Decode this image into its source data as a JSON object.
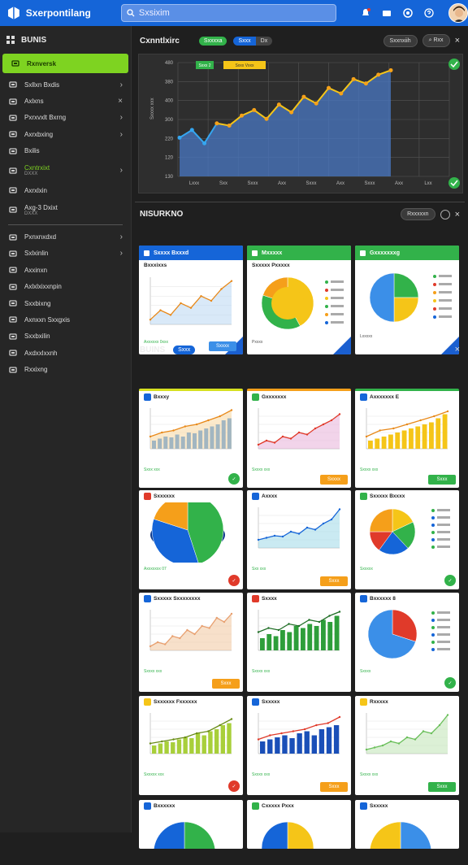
{
  "app": {
    "title": "Sxerpontilang",
    "search_placeholder": "Sxsixim"
  },
  "sidebar": {
    "header": "BUNIS",
    "items": [
      {
        "label": "Rxnversk",
        "active": true
      },
      {
        "label": "Sxllxn Bxdis",
        "chev": "›"
      },
      {
        "label": "Axlxns",
        "chev": "×"
      },
      {
        "label": "Pxrxvxlt Bxrng",
        "chev": "›"
      },
      {
        "label": "Axrxbxing",
        "chev": "›"
      },
      {
        "label": "Bxilis"
      },
      {
        "label": "Cxntrxixt",
        "sub": "DXXX",
        "green": true,
        "chev": "›"
      },
      {
        "label": "Axrxlxin"
      },
      {
        "label": "Axg-3 Dxixt",
        "sub": "DXXX"
      },
      {
        "label": "Pxnxnxdxd",
        "chev": "›"
      },
      {
        "label": "Sxlxinlin",
        "chev": "›"
      },
      {
        "label": "Axxinxn"
      },
      {
        "label": "Axlxlxixxnpin"
      },
      {
        "label": "Sxxbixng"
      },
      {
        "label": "Axnxxn Sxxgxis"
      },
      {
        "label": "Sxxbxilin"
      },
      {
        "label": "Axdxxlxxnh"
      },
      {
        "label": "Rxxixng"
      }
    ]
  },
  "overview": {
    "title": "Cxnntlxirc",
    "pill_a": "Sxxxxa",
    "pill_b": "Sxxx",
    "pill_c": "Dx",
    "btn_a": "Sxxnxiih",
    "btn_b": "Rxx",
    "chart_data": {
      "type": "line",
      "yticks": [
        "480",
        "380",
        "400",
        "300",
        "220",
        "120",
        "130"
      ],
      "xticks": [
        "Lxxx",
        "Sxx",
        "Sxxx",
        "Axx",
        "Sxxx",
        "Axx",
        "Sxxx",
        "Axx",
        "Lxx"
      ],
      "callout_a": "Sxxx 2",
      "callout_b": "Sxxx Vxxx",
      "values": [
        0.35,
        0.42,
        0.3,
        0.48,
        0.46,
        0.55,
        0.6,
        0.52,
        0.65,
        0.58,
        0.72,
        0.66,
        0.8,
        0.75,
        0.88,
        0.84,
        0.92,
        0.96
      ]
    }
  },
  "section2": {
    "title": "NISURKNO",
    "btn": "Rxxxxxn",
    "cards": [
      {
        "head": "Sxxxx Bxxxd",
        "title": "Bxxxixxs",
        "foot": "Axxxxxx 0xxx",
        "badge": "Sxxxx"
      },
      {
        "head": "Mxxxxx",
        "title": "Sxxxxx Pxxxxx",
        "foot": "Pxxxx"
      },
      {
        "head": "Gxxxxxxxg",
        "title": "",
        "foot": "Lxxxxx"
      }
    ]
  },
  "section3": {
    "title": "BUINS",
    "pill": "Sxxx",
    "cards": [
      {
        "title": "Bxxxy",
        "foot": "Sxxx xxx",
        "badge": ""
      },
      {
        "title": "Gxxxxxxx",
        "foot": "Sxxxx xxx",
        "badge": "Sxxxx"
      },
      {
        "title": "Axxxxxxx E",
        "foot": "Sxxxx xxx",
        "badge": "Sxxx"
      },
      {
        "title": "Sxxxxxx",
        "foot": "Axxxxxxx 07",
        "badge": ""
      },
      {
        "title": "Axxxx",
        "foot": "Sxx xxx",
        "badge": "Sxxx"
      },
      {
        "title": "Sxxxxx Bxxxx",
        "foot": "Sxxxxx",
        "badge": ""
      },
      {
        "title": "Sxxxxx Sxxxxxxxx",
        "foot": "Sxxxx xxx",
        "badge": "Sxxx"
      },
      {
        "title": "Sxxxx",
        "foot": "Sxxxx xxx",
        "badge": ""
      },
      {
        "title": "Bxxxxxx 8",
        "foot": "Sxxxx",
        "badge": ""
      },
      {
        "title": "Sxxxxxx Fxxxxxx",
        "foot": "Sxxxxx xxx",
        "badge": ""
      },
      {
        "title": "Sxxxxx",
        "foot": "Sxxxx xxx",
        "badge": "Sxxx"
      },
      {
        "title": "Rxxxxx",
        "foot": "Sxxxx xxx",
        "badge": "Sxxx"
      },
      {
        "title": "Bxxxxxx",
        "foot": ""
      },
      {
        "title": "Cxxxxx Pxxx",
        "foot": ""
      },
      {
        "title": "Sxxxxx",
        "foot": ""
      }
    ]
  },
  "colors": {
    "accent": "#1565d8",
    "green": "#7ed321",
    "yellow": "#f5c518",
    "blue": "#1a5fd0",
    "orange": "#f59f1a",
    "red": "#e03a2a"
  }
}
